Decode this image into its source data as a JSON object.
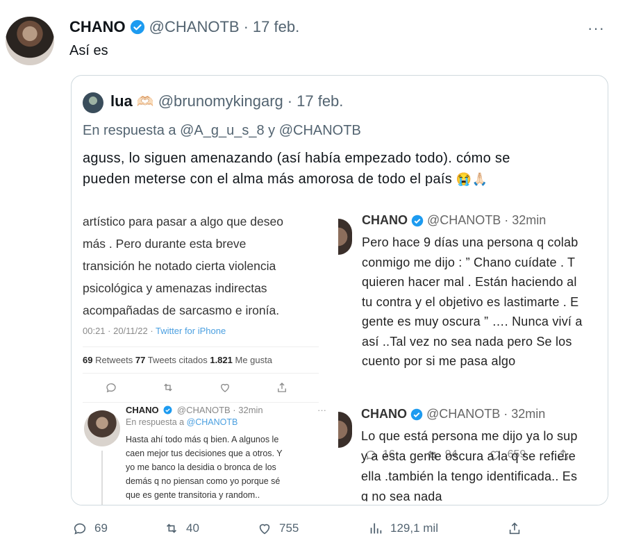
{
  "author": {
    "name": "CHANO",
    "handle": "@CHANOTB",
    "date": "17 feb.",
    "dot": "·"
  },
  "more": "···",
  "tweet_text": "Así es",
  "quote": {
    "name": "lua",
    "emoji": "🫶🏻",
    "handle": "@brunomykingarg",
    "dot": "·",
    "date": "17 feb.",
    "reply_line": "En respuesta a @A_g_u_s_8 y @CHANOTB",
    "body_line1": "aguss, lo siguen amenazando (así había empezado todo). cómo se",
    "body_line2": "pueden meterse con el alma más amorosa de todo el país",
    "body_emoji": "😭🙏🏻"
  },
  "shot_left": {
    "text_lines": [
      "artístico para pasar a algo que deseo",
      "más  . Pero durante esta breve",
      "transición he notado cierta violencia",
      "psicológica y amenazas indirectas",
      "acompañadas de sarcasmo e ironía."
    ],
    "meta_time": "00:21 · 20/11/22 · ",
    "meta_source": "Twitter for iPhone",
    "retweets": "69",
    "retweets_label": " Retweets  ",
    "quotes": "77",
    "quotes_label": " Tweets citados  ",
    "likes": "1.821",
    "likes_label": " Me gusta",
    "reply": {
      "name": "CHANO",
      "handle": "@CHANOTB · 32min",
      "more": "···",
      "reply_prefix": "En respuesta a ",
      "reply_handle": "@CHANOTB",
      "body_lines": [
        "Hasta ahí todo más q bien. A algunos le",
        "caen mejor tus decisiones que a otros. Y",
        "yo me banco la desidia o bronca de los",
        "demás q no piensan como yo  porque sé",
        "que es gente transitoria y random.."
      ]
    }
  },
  "shot_right": {
    "tweet1": {
      "name": "CHANO",
      "handle": "@CHANOTB",
      "dot": "·",
      "time": "32min",
      "body_lines": [
        "Pero hace 9 días una persona q colab",
        "conmigo me dijo : ” Chano cuídate . T",
        "quieren hacer mal . Están haciendo al",
        "tu contra y el objetivo es lastimarte . E",
        "gente es muy oscura ” …. Nunca viví a",
        "así ..Tal vez no sea nada pero  Se los",
        "cuento por si me pasa algo"
      ],
      "replies": "16",
      "retweets": "94",
      "likes": "659"
    },
    "tweet2": {
      "name": "CHANO",
      "handle": "@CHANOTB",
      "dot": "·",
      "time": "32min",
      "body_lines": [
        "Lo que está persona me dijo ya lo sup",
        "y a esta gente oscura a la q se refiere",
        "ella .también la tengo identificada.. Es",
        "q no sea nada"
      ]
    }
  },
  "actions": {
    "replies": "69",
    "retweets": "40",
    "likes": "755",
    "views": "129,1 mil"
  },
  "colors": {
    "verified": "#1d9bf0",
    "muted": "#536471",
    "border": "#cfd9de"
  }
}
